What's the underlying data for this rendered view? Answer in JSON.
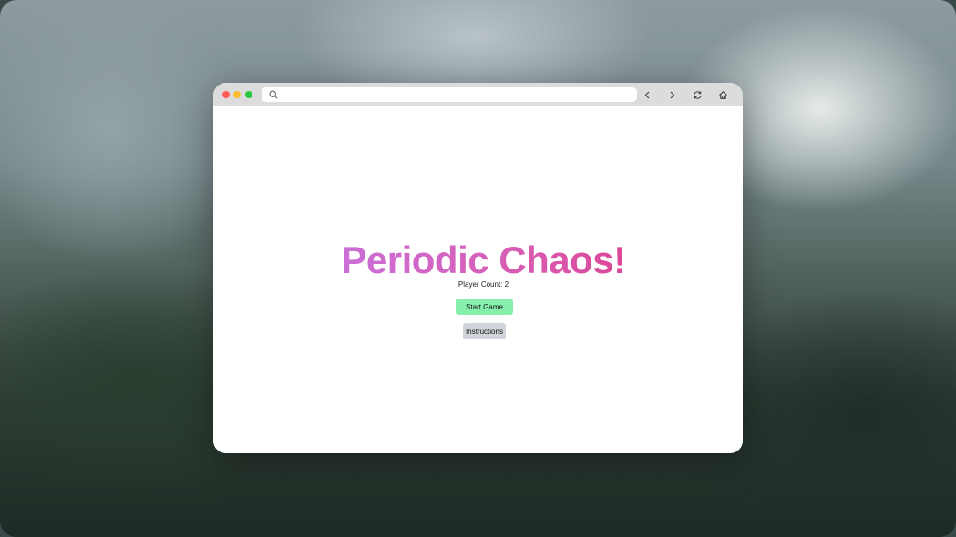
{
  "browser": {
    "url": "",
    "icons": {
      "search": "search-icon",
      "back": "chevron-left-icon",
      "forward": "chevron-right-icon",
      "reload": "reload-icon",
      "home": "home-icon"
    }
  },
  "page": {
    "title": "Periodic Chaos!",
    "player_count_text": "Player Count: 2",
    "start_button_label": "Start Game",
    "instructions_button_label": "Instructions"
  },
  "colors": {
    "title_gradient_start": "#c17cf0",
    "title_gradient_end": "#e0307a",
    "start_button": "#86efac",
    "instructions_button": "#d1d5db"
  }
}
